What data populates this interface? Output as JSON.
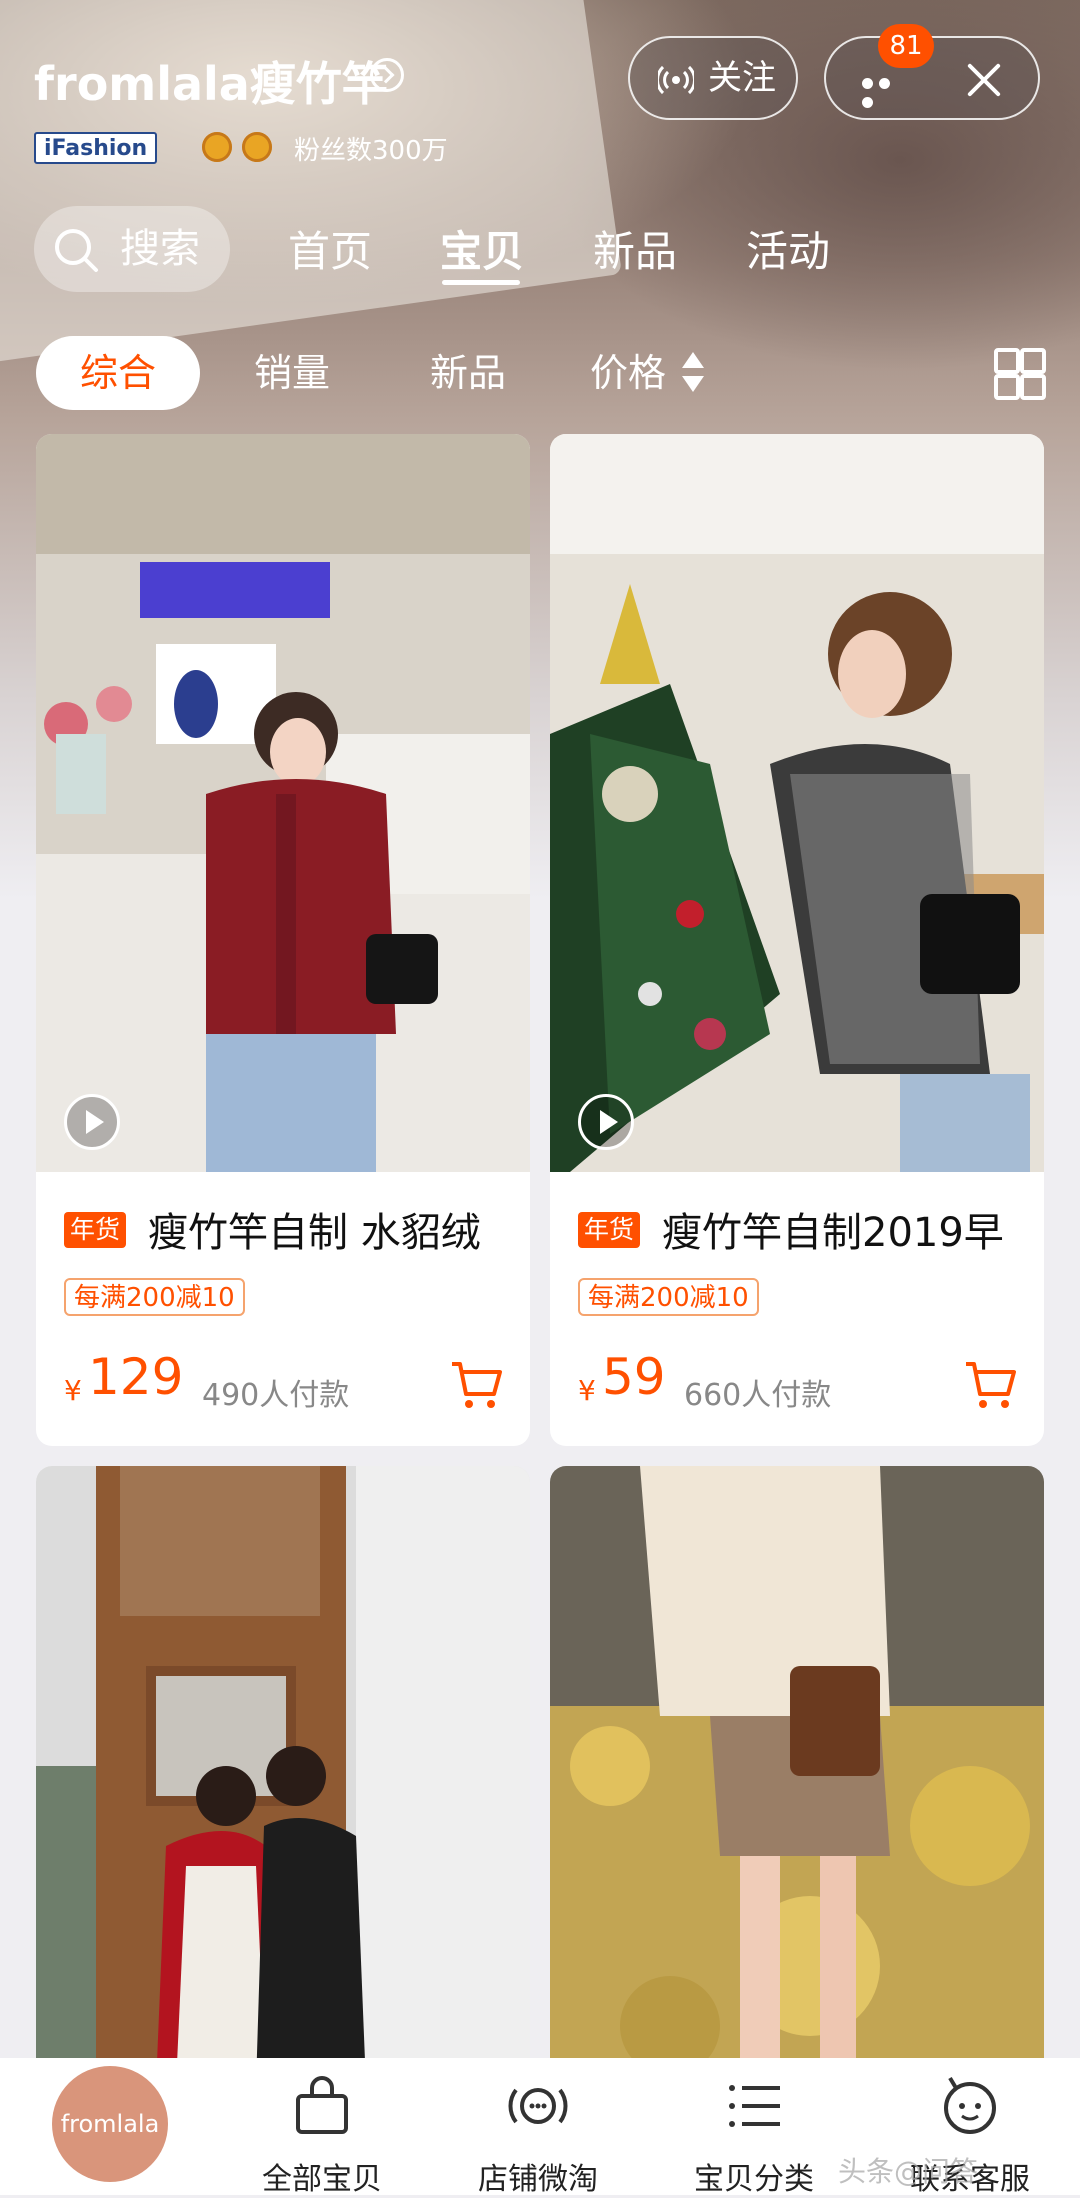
{
  "header": {
    "shop_name": "fromlala瘦竹竿",
    "badge": "iFashion",
    "fans": "粉丝数300万",
    "follow_label": "关注",
    "notification_count": "81"
  },
  "search": {
    "label": "搜索"
  },
  "nav_tabs": [
    {
      "label": "首页"
    },
    {
      "label": "宝贝"
    },
    {
      "label": "新品"
    },
    {
      "label": "活动"
    }
  ],
  "sort_tabs": [
    {
      "label": "综合"
    },
    {
      "label": "销量"
    },
    {
      "label": "新品"
    },
    {
      "label": "价格"
    }
  ],
  "products": [
    {
      "tag": "年货",
      "title": "瘦竹竿自制 水貂绒",
      "promo": "每满200减10",
      "currency": "¥",
      "price": "129",
      "sold": "490人付款"
    },
    {
      "tag": "年货",
      "title": "瘦竹竿自制2019早",
      "promo": "每满200减10",
      "currency": "¥",
      "price": "59",
      "sold": "660人付款"
    }
  ],
  "bottom_nav": {
    "logo": "fromlala",
    "items": [
      {
        "label": "全部宝贝"
      },
      {
        "label": "店铺微淘"
      },
      {
        "label": "宝贝分类"
      },
      {
        "label": "联系客服"
      }
    ]
  },
  "watermark": "头条@问答",
  "colors": {
    "accent": "#ff5000",
    "brand_badge": "#274a8c"
  }
}
